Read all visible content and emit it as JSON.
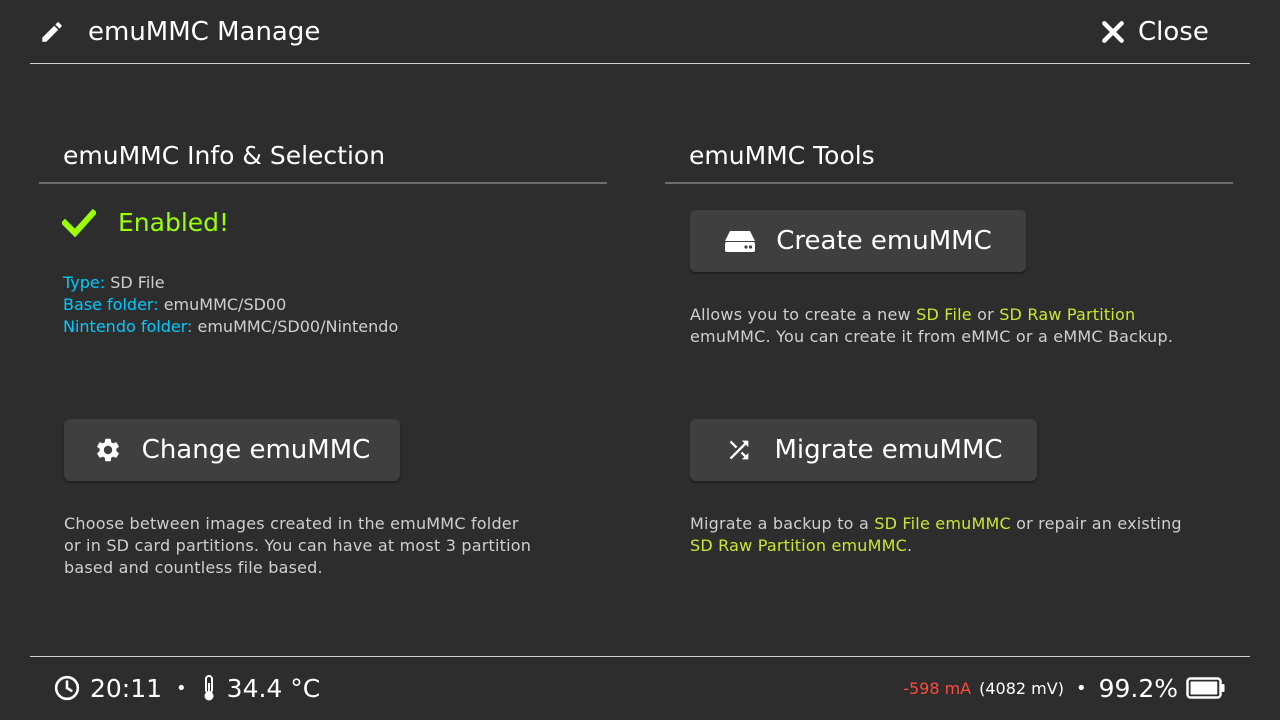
{
  "header": {
    "title": "emuMMC Manage",
    "close_label": "Close",
    "icon": "pencil-icon"
  },
  "left_section": {
    "title": "emuMMC Info & Selection",
    "status": "Enabled!",
    "info": [
      {
        "key": "Type:",
        "value": "SD File"
      },
      {
        "key": "Base folder:",
        "value": "emuMMC/SD00"
      },
      {
        "key": "Nintendo folder:",
        "value": "emuMMC/SD00/Nintendo"
      }
    ],
    "change_button": "Change emuMMC",
    "change_desc": [
      "Choose between images created in the emuMMC folder",
      "or in SD card partitions. You can have at most 3 partition",
      "based and countless file based."
    ]
  },
  "right_section": {
    "title": "emuMMC Tools",
    "create_button": "Create emuMMC",
    "create_desc": {
      "p1": "Allows you to create a new ",
      "h1": "SD File",
      "p2": " or ",
      "h2": "SD Raw Partition",
      "line2": "emuMMC. You can create it from eMMC or a eMMC Backup."
    },
    "migrate_button": "Migrate emuMMC",
    "migrate_desc": {
      "p1": "Migrate a backup to a ",
      "h1": "SD File emuMMC",
      "p2": " or repair an existing",
      "h2": "SD Raw Partition emuMMC",
      "p3": "."
    }
  },
  "footer": {
    "time": "20:11",
    "temperature": "34.4 °C",
    "current": "-598 mA",
    "voltage": "(4082 mV)",
    "battery": "99.2%",
    "battery_level": 0.992
  },
  "colors": {
    "background": "#2d2d2d",
    "cyan_key": "#00c9ff",
    "enabled_green": "#9bff00",
    "highlight_yellow": "#c8e830",
    "current_red": "#ff4a3d",
    "button_bg": "#3f3f3f"
  }
}
